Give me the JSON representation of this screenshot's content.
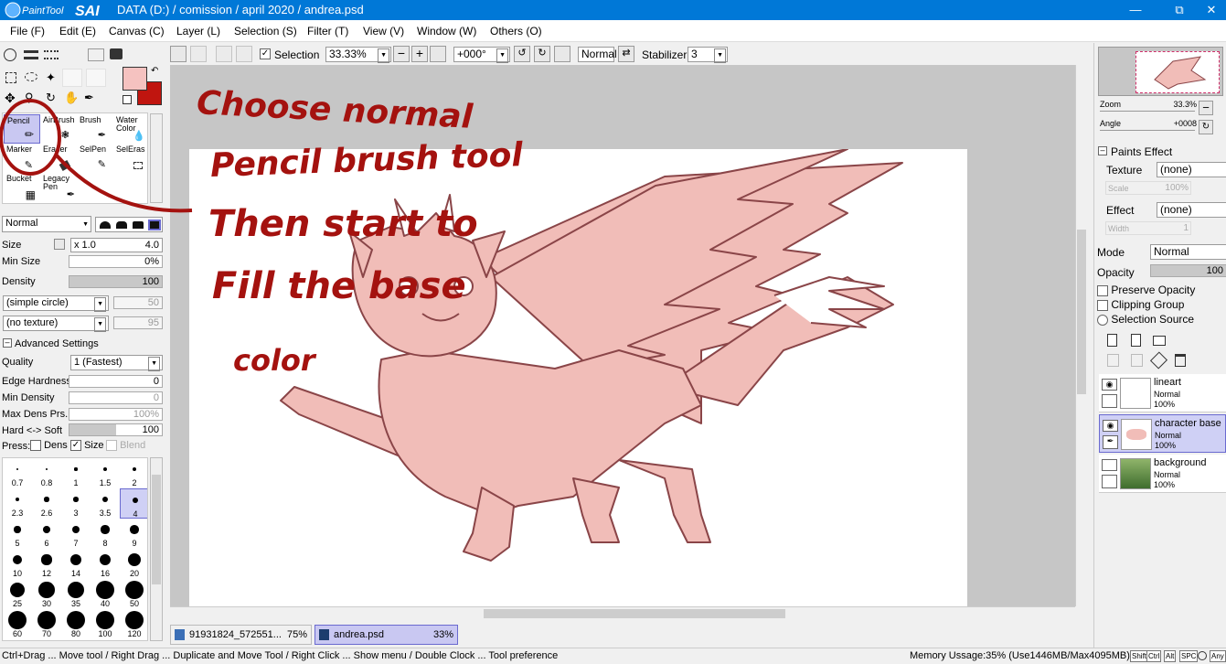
{
  "app": {
    "logo_text": "PaintTool SAI",
    "title": "DATA (D:) / comission / april 2020 / andrea.psd"
  },
  "menu": [
    "File (F)",
    "Edit (E)",
    "Canvas (C)",
    "Layer (L)",
    "Selection (S)",
    "Filter (T)",
    "View (V)",
    "Window (W)",
    "Others (O)"
  ],
  "toolbar": {
    "selection_label": "Selection",
    "zoom": "33.33%",
    "angle": "+000°",
    "blend": "Normal",
    "stabilizer_label": "Stabilizer",
    "stabilizer": "3"
  },
  "tools": [
    {
      "label": "Pencil",
      "selected": true
    },
    {
      "label": "AirBrush"
    },
    {
      "label": "Brush"
    },
    {
      "label": "Water Color"
    },
    {
      "label": "Marker"
    },
    {
      "label": "Eraser"
    },
    {
      "label": "SelPen"
    },
    {
      "label": "SelEras"
    },
    {
      "label": "Bucket"
    },
    {
      "label": "Legacy Pen"
    }
  ],
  "brush": {
    "mode": "Normal",
    "size_label": "Size",
    "size_mult": "x 1.0",
    "size_value": "4.0",
    "min_size_label": "Min Size",
    "min_size_value": "0%",
    "density_label": "Density",
    "density_value": "100",
    "shape": "(simple circle)",
    "shape_value": "50",
    "texture": "(no texture)",
    "texture_value": "95",
    "advanced_label": "Advanced Settings",
    "quality_label": "Quality",
    "quality": "1 (Fastest)",
    "edge_label": "Edge Hardness",
    "edge_value": "0",
    "min_density_label": "Min Density",
    "min_density_value": "0",
    "max_dens_label": "Max Dens Prs.",
    "max_dens_value": "100%",
    "hard_soft_label": "Hard <-> Soft",
    "hard_soft_value": "100",
    "press_label": "Press:",
    "press_dens": "Dens",
    "press_size": "Size",
    "press_blend": "Blend"
  },
  "brush_sizes": [
    "0.7",
    "0.8",
    "1",
    "1.5",
    "2",
    "2.3",
    "2.6",
    "3",
    "3.5",
    "4",
    "5",
    "6",
    "7",
    "8",
    "9",
    "10",
    "12",
    "14",
    "16",
    "20",
    "25",
    "30",
    "35",
    "40",
    "50",
    "60",
    "70",
    "80",
    "100",
    "120"
  ],
  "tabs": [
    {
      "name": "91931824_572551...",
      "zoom": "75%"
    },
    {
      "name": "andrea.psd",
      "zoom": "33%"
    }
  ],
  "annotation": {
    "line1": "Choose normal",
    "line2": "Pencil brush tool",
    "line3": "Then start to",
    "line4": "Fill the base",
    "line5": "color"
  },
  "navigator": {
    "zoom_label": "Zoom",
    "zoom": "33.3%",
    "angle_label": "Angle",
    "angle": "+0008"
  },
  "paints_effect": {
    "header": "Paints Effect",
    "texture_label": "Texture",
    "texture": "(none)",
    "scale_label": "Scale",
    "scale": "100%",
    "effect_label": "Effect",
    "effect": "(none)",
    "width_label": "Width",
    "width": "1"
  },
  "layer_props": {
    "mode_label": "Mode",
    "mode": "Normal",
    "opacity_label": "Opacity",
    "opacity": "100",
    "preserve": "Preserve Opacity",
    "clipping": "Clipping Group",
    "selsource": "Selection Source"
  },
  "layers": [
    {
      "name": "lineart",
      "mode": "Normal",
      "opacity": "100%",
      "selected": false
    },
    {
      "name": "character base",
      "mode": "Normal",
      "opacity": "100%",
      "selected": true
    },
    {
      "name": "background",
      "mode": "Normal",
      "opacity": "100%",
      "selected": false
    }
  ],
  "status": {
    "text": "Ctrl+Drag ... Move tool / Right Drag ... Duplicate and Move Tool / Right Click ... Show menu / Double Clock ... Tool preference",
    "memory": "Memory Ussage:35% (Use1446MB/Max4095MB)",
    "keys": [
      "Shift",
      "Ctrl",
      "Alt",
      "SPC"
    ],
    "any": "Any"
  },
  "colors": {
    "primary": "#f5c2c0",
    "secondary": "#c0150f",
    "accent_select": "#c9c8f2",
    "annotation": "#a4120f",
    "title": "#0078d7",
    "creature_fill": "#f1bdb8",
    "creature_line": "#8a4548"
  }
}
